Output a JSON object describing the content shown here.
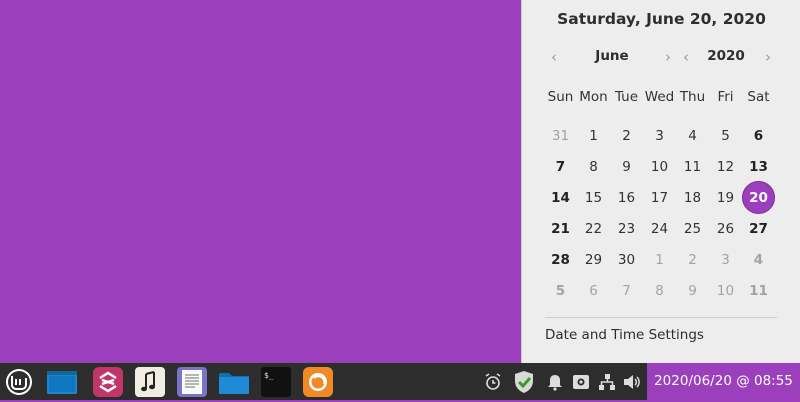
{
  "calendar": {
    "full_date": "Saturday, June 20, 2020",
    "month": "June",
    "year": "2020",
    "weekdays": [
      "Sun",
      "Mon",
      "Tue",
      "Wed",
      "Thu",
      "Fri",
      "Sat"
    ],
    "weeks": [
      [
        "31",
        "1",
        "2",
        "3",
        "4",
        "5",
        "6"
      ],
      [
        "7",
        "8",
        "9",
        "10",
        "11",
        "12",
        "13"
      ],
      [
        "14",
        "15",
        "16",
        "17",
        "18",
        "19",
        "20"
      ],
      [
        "21",
        "22",
        "23",
        "24",
        "25",
        "26",
        "27"
      ],
      [
        "28",
        "29",
        "30",
        "1",
        "2",
        "3",
        "4"
      ],
      [
        "5",
        "6",
        "7",
        "8",
        "9",
        "10",
        "11"
      ]
    ],
    "selected_day": "20",
    "settings_label": "Date and Time Settings"
  },
  "panel": {
    "clock": "2020/06/20 @ 08:55",
    "launchers": [
      "mint-menu-icon",
      "show-desktop-icon",
      "update-manager-icon",
      "music-player-icon",
      "text-editor-icon",
      "files-icon",
      "terminal-icon",
      "firefox-icon"
    ],
    "tray": [
      "alarm-clock-icon",
      "shield-check-icon",
      "notification-bell-icon",
      "keyboard-layout-icon",
      "network-icon",
      "volume-icon"
    ]
  },
  "colors": {
    "desktop": "#9b3fbd",
    "panel": "#2d2d2d",
    "accent": "#9b3fbd"
  }
}
